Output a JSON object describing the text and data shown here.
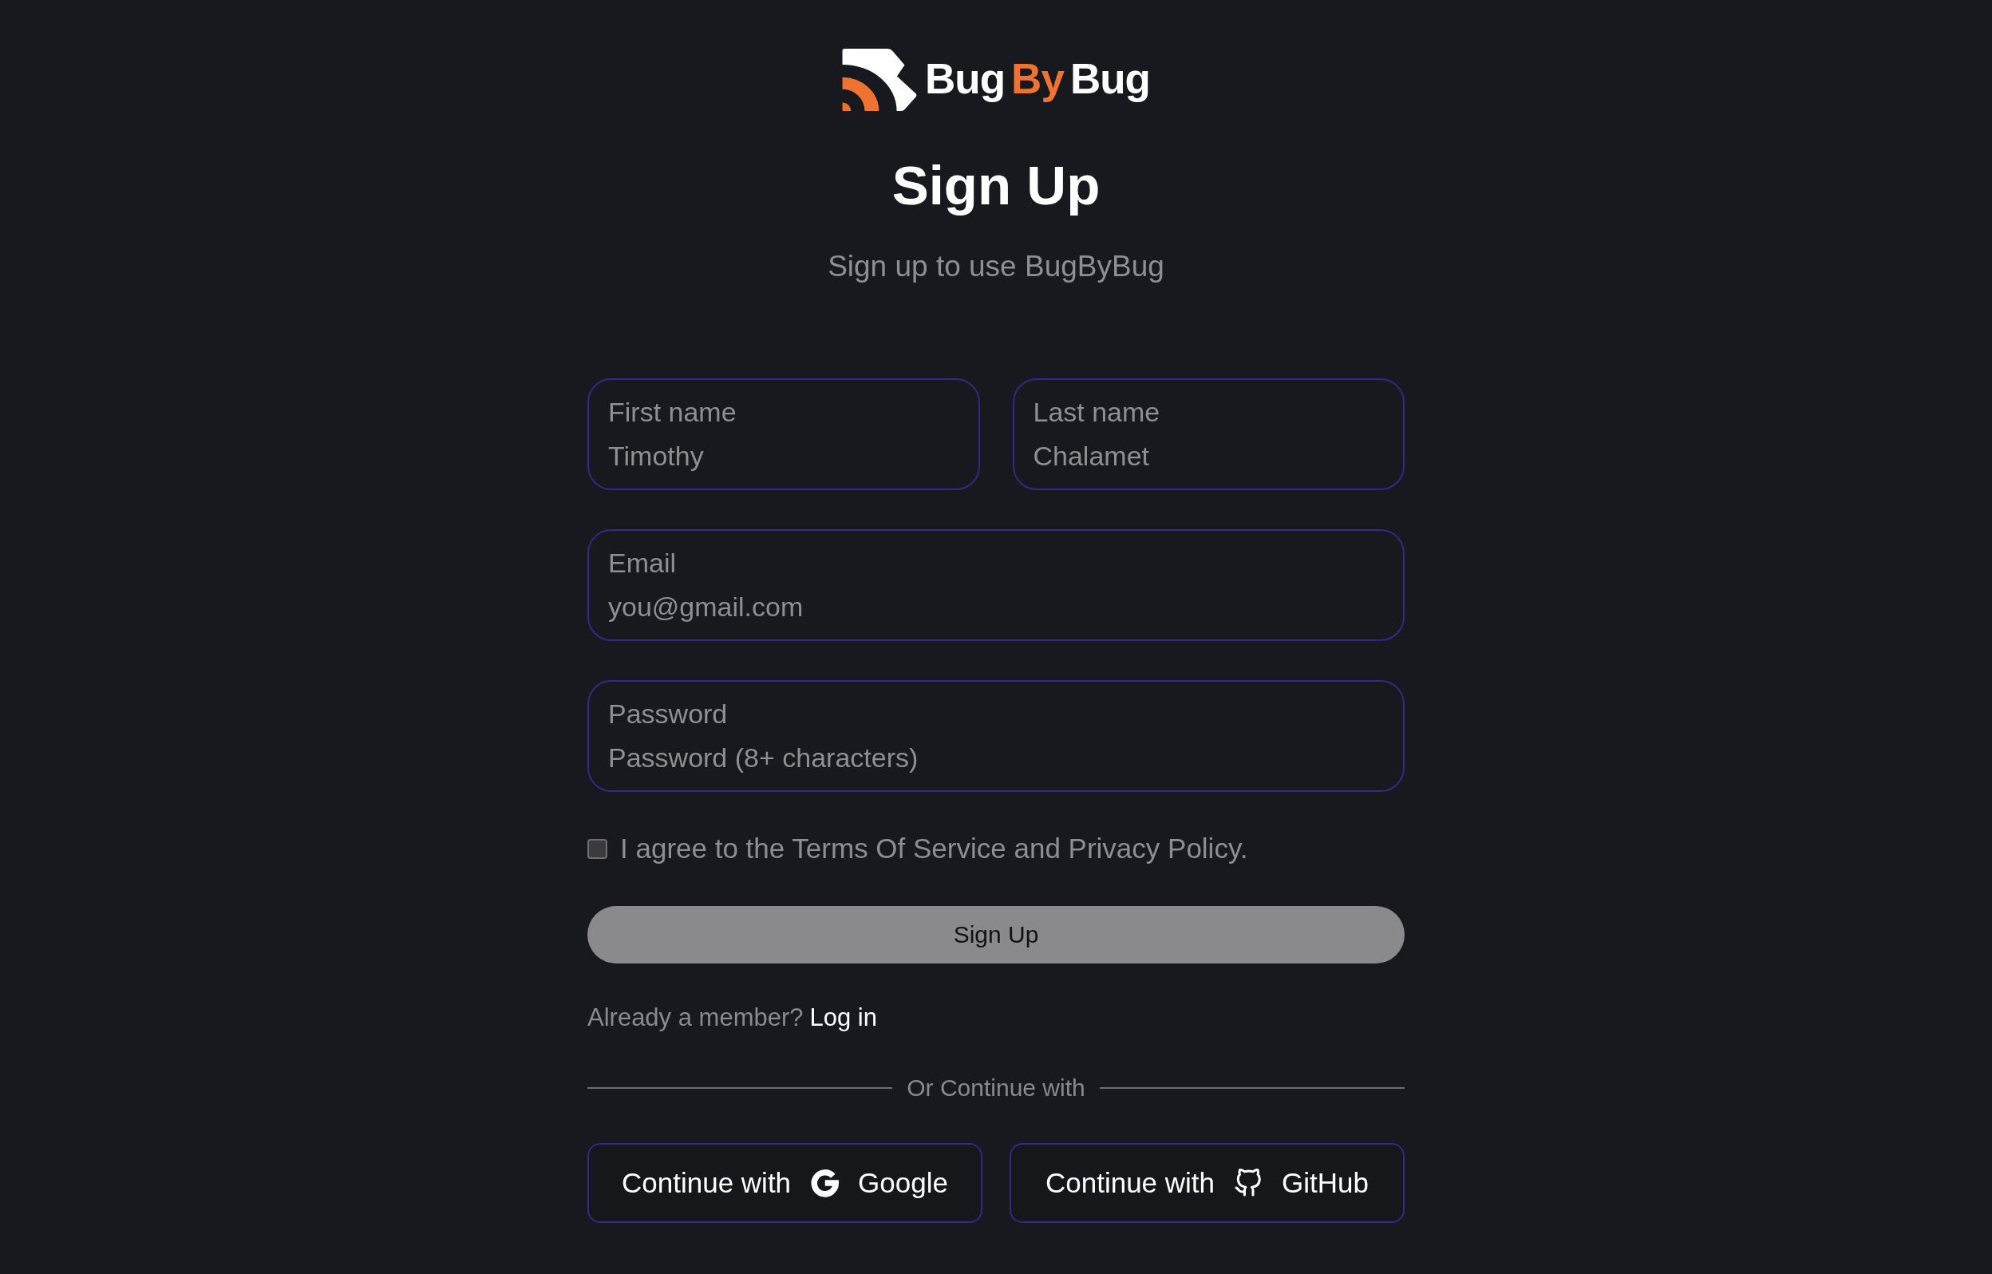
{
  "logo": {
    "parts": [
      {
        "text": "Bug",
        "accent": false
      },
      {
        "text": "By",
        "accent": true
      },
      {
        "text": "Bug",
        "accent": false
      }
    ]
  },
  "title": "Sign Up",
  "subtitle": "Sign up to use BugByBug",
  "form": {
    "rows": [
      {
        "fields": [
          {
            "label": "First name",
            "placeholder": "Timothy"
          },
          {
            "label": "Last name",
            "placeholder": "Chalamet"
          }
        ]
      },
      {
        "fields": [
          {
            "label": "Email",
            "placeholder": "you@gmail.com"
          }
        ]
      },
      {
        "fields": [
          {
            "label": "Password",
            "placeholder": "Password (8+ characters)"
          }
        ]
      }
    ]
  },
  "terms": {
    "checked": false,
    "text": "I agree to the Terms Of Service and Privacy Policy."
  },
  "submit": {
    "label": "Sign Up",
    "disabled": true
  },
  "login_prompt": {
    "text": "Already a member?",
    "link": "Log in"
  },
  "divider": "Or Continue with",
  "social": [
    {
      "kind": "google",
      "prefix": "Continue with",
      "provider": "Google"
    },
    {
      "kind": "github",
      "prefix": "Continue with",
      "provider": "GitHub"
    }
  ]
}
